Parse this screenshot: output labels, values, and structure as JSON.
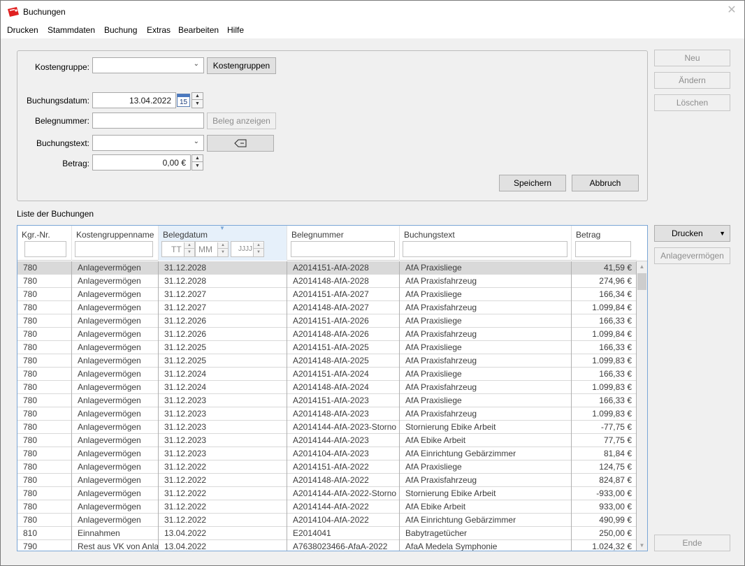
{
  "window": {
    "title": "Buchungen",
    "close_glyph": "✕"
  },
  "menu": [
    "Drucken",
    "Stammdaten",
    "Buchung",
    "Extras",
    "Bearbeiten",
    "Hilfe"
  ],
  "form": {
    "kostengruppe_label": "Kostengruppe:",
    "kostengruppe_value": "",
    "kostengruppen_button": "Kostengruppen",
    "buchungsdatum_label": "Buchungsdatum:",
    "buchungsdatum_value": "13.04.2022",
    "calendar_day": "15",
    "belegnummer_label": "Belegnummer:",
    "belegnummer_value": "",
    "beleg_anzeigen_button": "Beleg anzeigen",
    "buchungstext_label": "Buchungstext:",
    "buchungstext_value": "",
    "betrag_label": "Betrag:",
    "betrag_value": "0,00 €",
    "speichern_button": "Speichern",
    "abbruch_button": "Abbruch"
  },
  "side_buttons": {
    "neu": "Neu",
    "aendern": "Ändern",
    "loeschen": "Löschen",
    "drucken": "Drucken",
    "anlagevermoegen": "Anlagevermögen",
    "ende": "Ende"
  },
  "list_label": "Liste der Buchungen",
  "columns": [
    "Kgr.-Nr.",
    "Kostengruppenname",
    "Belegdatum",
    "Belegnummer",
    "Buchungstext",
    "Betrag"
  ],
  "date_filter": {
    "day": "TT",
    "month": "MM",
    "year": "JJJJ"
  },
  "rows": [
    [
      "780",
      "Anlagevermögen",
      "31.12.2028",
      "A2014151-AfA-2028",
      "AfA Praxisliege",
      "41,59 €"
    ],
    [
      "780",
      "Anlagevermögen",
      "31.12.2028",
      "A2014148-AfA-2028",
      "AfA Praxisfahrzeug",
      "274,96 €"
    ],
    [
      "780",
      "Anlagevermögen",
      "31.12.2027",
      "A2014151-AfA-2027",
      "AfA Praxisliege",
      "166,34 €"
    ],
    [
      "780",
      "Anlagevermögen",
      "31.12.2027",
      "A2014148-AfA-2027",
      "AfA Praxisfahrzeug",
      "1.099,84 €"
    ],
    [
      "780",
      "Anlagevermögen",
      "31.12.2026",
      "A2014151-AfA-2026",
      "AfA Praxisliege",
      "166,33 €"
    ],
    [
      "780",
      "Anlagevermögen",
      "31.12.2026",
      "A2014148-AfA-2026",
      "AfA Praxisfahrzeug",
      "1.099,84 €"
    ],
    [
      "780",
      "Anlagevermögen",
      "31.12.2025",
      "A2014151-AfA-2025",
      "AfA Praxisliege",
      "166,33 €"
    ],
    [
      "780",
      "Anlagevermögen",
      "31.12.2025",
      "A2014148-AfA-2025",
      "AfA Praxisfahrzeug",
      "1.099,83 €"
    ],
    [
      "780",
      "Anlagevermögen",
      "31.12.2024",
      "A2014151-AfA-2024",
      "AfA Praxisliege",
      "166,33 €"
    ],
    [
      "780",
      "Anlagevermögen",
      "31.12.2024",
      "A2014148-AfA-2024",
      "AfA Praxisfahrzeug",
      "1.099,83 €"
    ],
    [
      "780",
      "Anlagevermögen",
      "31.12.2023",
      "A2014151-AfA-2023",
      "AfA Praxisliege",
      "166,33 €"
    ],
    [
      "780",
      "Anlagevermögen",
      "31.12.2023",
      "A2014148-AfA-2023",
      "AfA Praxisfahrzeug",
      "1.099,83 €"
    ],
    [
      "780",
      "Anlagevermögen",
      "31.12.2023",
      "A2014144-AfA-2023-Storno",
      "Stornierung Ebike Arbeit",
      "-77,75 €"
    ],
    [
      "780",
      "Anlagevermögen",
      "31.12.2023",
      "A2014144-AfA-2023",
      "AfA Ebike Arbeit",
      "77,75 €"
    ],
    [
      "780",
      "Anlagevermögen",
      "31.12.2023",
      "A2014104-AfA-2023",
      "AfA Einrichtung Gebärzimmer",
      "81,84 €"
    ],
    [
      "780",
      "Anlagevermögen",
      "31.12.2022",
      "A2014151-AfA-2022",
      "AfA Praxisliege",
      "124,75 €"
    ],
    [
      "780",
      "Anlagevermögen",
      "31.12.2022",
      "A2014148-AfA-2022",
      "AfA Praxisfahrzeug",
      "824,87 €"
    ],
    [
      "780",
      "Anlagevermögen",
      "31.12.2022",
      "A2014144-AfA-2022-Storno",
      "Stornierung Ebike Arbeit",
      "-933,00 €"
    ],
    [
      "780",
      "Anlagevermögen",
      "31.12.2022",
      "A2014144-AfA-2022",
      "AfA Ebike Arbeit",
      "933,00 €"
    ],
    [
      "780",
      "Anlagevermögen",
      "31.12.2022",
      "A2014104-AfA-2022",
      "AfA Einrichtung Gebärzimmer",
      "490,99 €"
    ],
    [
      "810",
      "Einnahmen",
      "13.04.2022",
      "E2014041",
      "Babytragetücher",
      "250,00 €"
    ],
    [
      "790",
      "Rest aus VK von Anlag",
      "13.04.2022",
      "A7638023466-AfaA-2022",
      "AfaA Medela Symphonie",
      "1.024,32 €"
    ]
  ],
  "colors": {
    "selection": "#d9d9d9",
    "grid_border": "#7aa6d6",
    "sorted_header": "#e6f0fa",
    "app_icon": "#e02020"
  }
}
